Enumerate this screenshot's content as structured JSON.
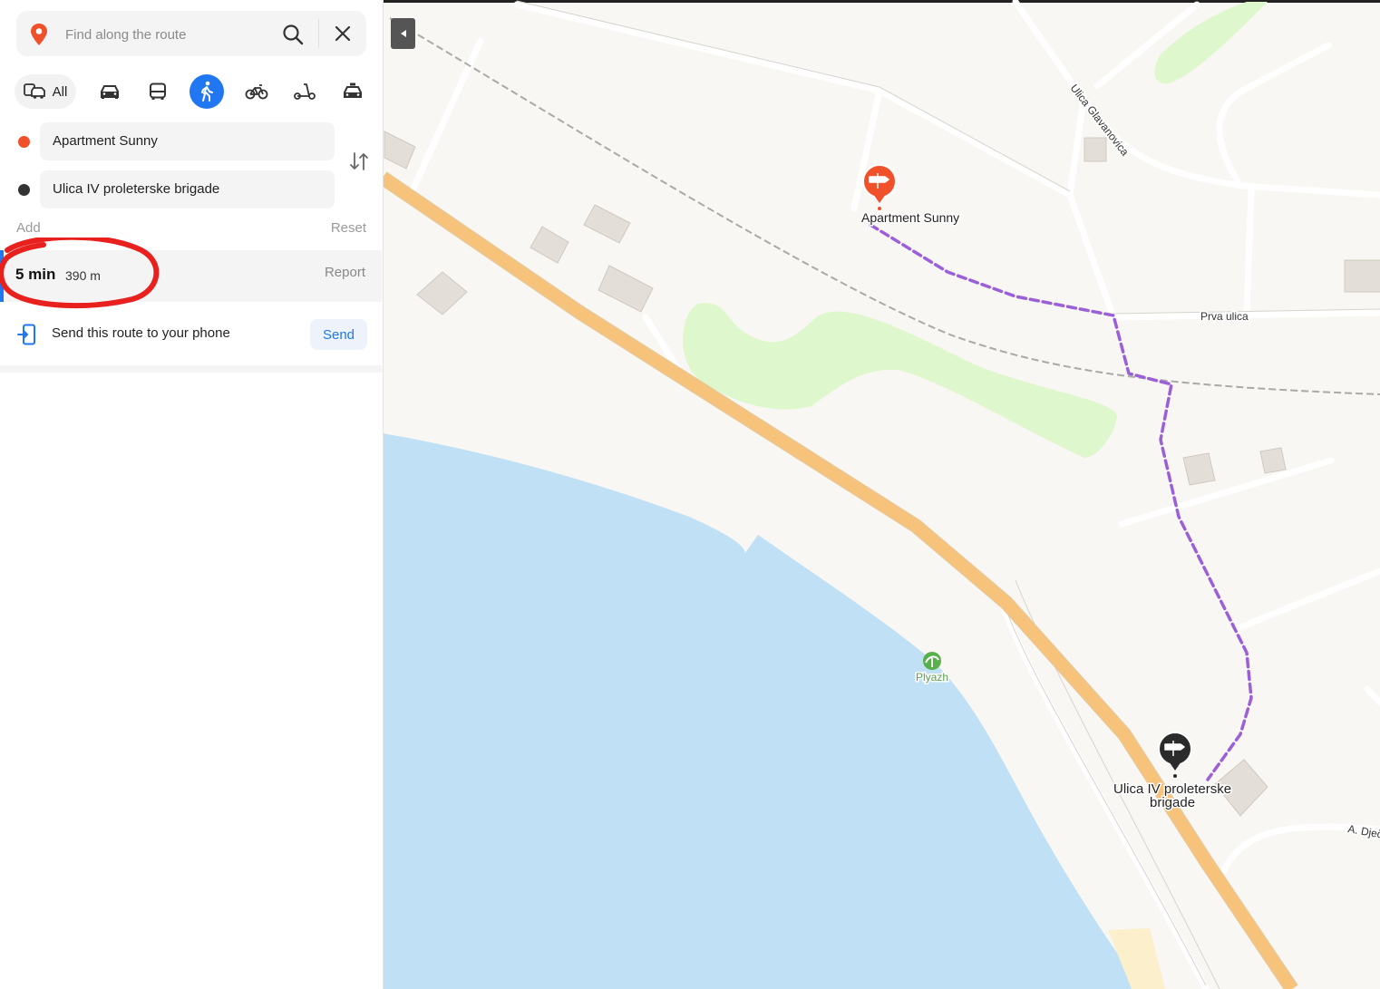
{
  "search": {
    "placeholder": "Find along the route"
  },
  "modes": {
    "all_label": "All"
  },
  "route": {
    "from": "Apartment Sunny",
    "to": "Ulica IV proleterske brigade",
    "add_label": "Add",
    "reset_label": "Reset",
    "time": "5 min",
    "distance": "390 m",
    "report_label": "Report",
    "send_text": "Send this route to your phone",
    "send_label": "Send"
  },
  "map": {
    "start_label": "Apartment Sunny",
    "end_label_line1": "Ulica IV proleterske",
    "end_label_line2": "brigade",
    "street_glavanovica": "Ulica Glavanovica",
    "street_prva": "Prva ulica",
    "street_a_dje": "A. Dječ",
    "poi_beach": "Plyazh"
  },
  "colors": {
    "accent": "#2177f2",
    "start_marker": "#f0502a",
    "route_line": "#9b5fd8",
    "highway": "#f7c27a",
    "water": "#bfe0f5",
    "park": "#dff7cc"
  }
}
